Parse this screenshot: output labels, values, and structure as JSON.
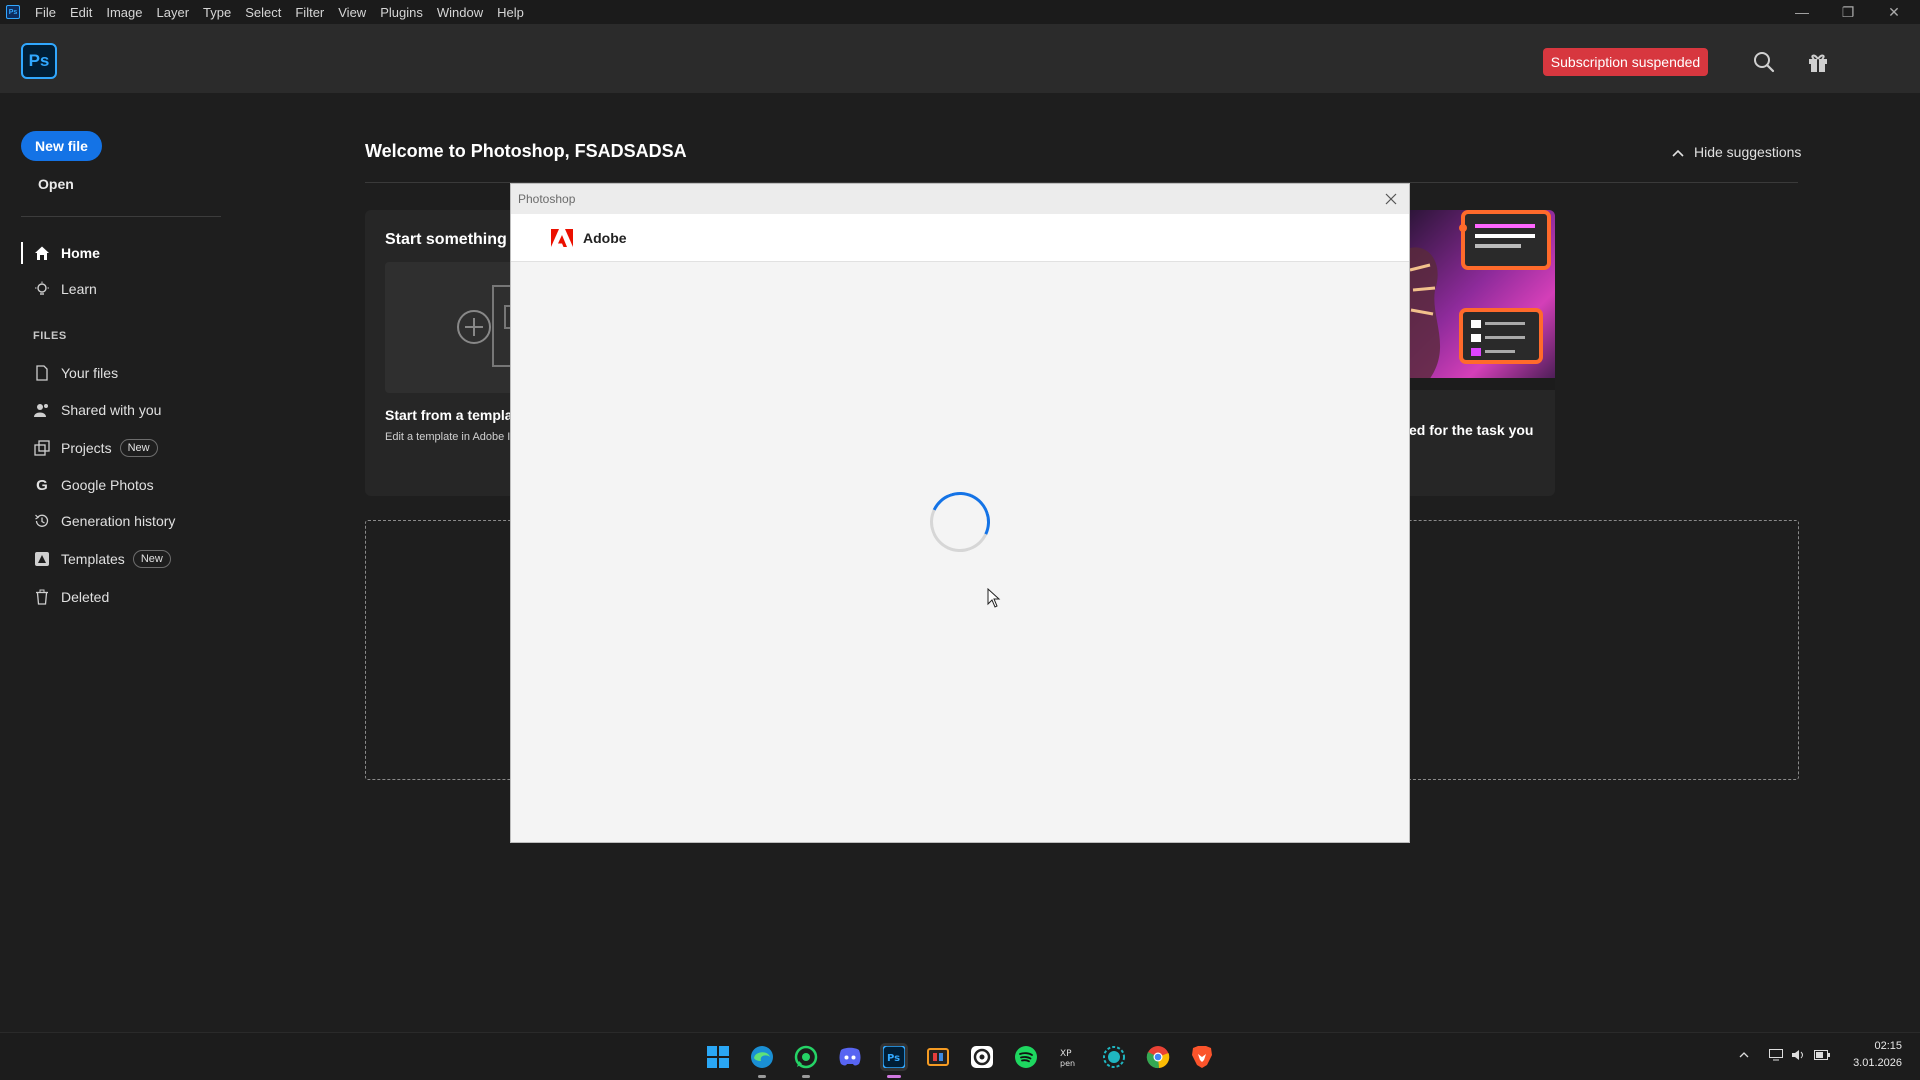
{
  "menubar": {
    "items": [
      "File",
      "Edit",
      "Image",
      "Layer",
      "Type",
      "Select",
      "Filter",
      "View",
      "Plugins",
      "Window",
      "Help"
    ],
    "minimize": "—",
    "restore": "❐",
    "close": "✕"
  },
  "header": {
    "logo": "Ps",
    "subscription_label": "Subscription suspended"
  },
  "sidebar": {
    "new_file": "New file",
    "open": "Open",
    "nav": [
      {
        "label": "Home",
        "icon": "home-icon"
      },
      {
        "label": "Learn",
        "icon": "lightbulb-icon"
      }
    ],
    "files_heading": "FILES",
    "files": [
      {
        "label": "Your files",
        "icon": "document-icon"
      },
      {
        "label": "Shared with you",
        "icon": "people-icon"
      },
      {
        "label": "Projects",
        "icon": "projects-icon",
        "badge": "New"
      },
      {
        "label": "Google Photos",
        "icon": "google-icon"
      },
      {
        "label": "Generation history",
        "icon": "history-icon"
      },
      {
        "label": "Templates",
        "icon": "templates-icon",
        "badge": "New"
      },
      {
        "label": "Deleted",
        "icon": "trash-icon"
      }
    ]
  },
  "main": {
    "welcome": "Welcome to Photoshop, FSADSADSA",
    "hide_suggestions": "Hide suggestions",
    "card_title": "Start something ne",
    "template_title": "Start from a template",
    "template_subtitle": "Edit a template in Adobe I",
    "task_text": "ed for the task you"
  },
  "dialog": {
    "title": "Photoshop",
    "brand": "Adobe"
  },
  "taskbar": {
    "apps": [
      {
        "name": "windows-start-icon",
        "color": "#2aa7f5"
      },
      {
        "name": "edge-icon",
        "color": "#25a3e0"
      },
      {
        "name": "whatsapp-icon",
        "color": "#25d366"
      },
      {
        "name": "discord-icon",
        "color": "#5865f2"
      },
      {
        "name": "photoshop-icon",
        "color": "#31a8ff"
      },
      {
        "name": "app-icon",
        "color": "#f59b23"
      },
      {
        "name": "obs-icon",
        "color": "#ffffff"
      },
      {
        "name": "spotify-icon",
        "color": "#1ed760"
      },
      {
        "name": "xppen-icon",
        "color": "#cccccc"
      },
      {
        "name": "teal-app-icon",
        "color": "#1fb6c1"
      },
      {
        "name": "chrome-icon",
        "color": "#e94235"
      },
      {
        "name": "brave-icon",
        "color": "#fb542b"
      }
    ],
    "time": "02:15",
    "date": "3.01.2026"
  }
}
